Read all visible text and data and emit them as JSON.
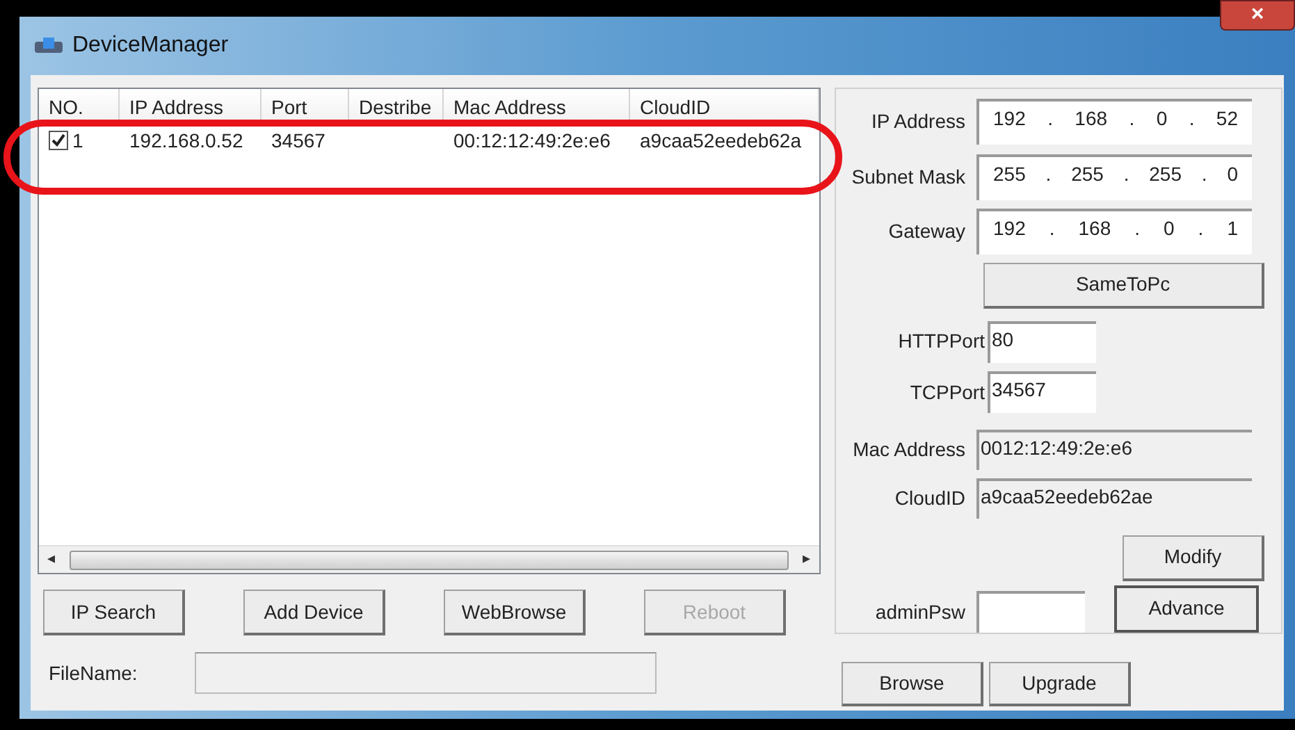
{
  "window": {
    "title": "DeviceManager",
    "close": "×"
  },
  "table": {
    "columns": [
      "NO.",
      "IP Address",
      "Port",
      "Destribe",
      "Mac Address",
      "CloudID"
    ],
    "rows": [
      {
        "checked": true,
        "selected": false,
        "cells": [
          "1",
          "192.168.0.52",
          "34567",
          "",
          "00:12:12:49:2e:e6",
          "a9caa52eedeb62a"
        ]
      }
    ],
    "scroll_left": "◂",
    "scroll_right": "▸"
  },
  "buttons": [
    {
      "label": "IP Search",
      "disabled": false
    },
    {
      "label": "Add Device",
      "disabled": false
    },
    {
      "label": "WebBrowse",
      "disabled": false
    },
    {
      "label": "Reboot",
      "disabled": true
    }
  ],
  "file": {
    "label": "FileName:"
  },
  "settings": {
    "octet_separator": ".",
    "ip_fields": [
      {
        "label": "IP Address",
        "octets": [
          "192",
          "168",
          "0",
          "52"
        ]
      },
      {
        "label": "Subnet Mask",
        "octets": [
          "255",
          "255",
          "255",
          "0"
        ]
      },
      {
        "label": "Gateway",
        "octets": [
          "192",
          "168",
          "0",
          "1"
        ]
      }
    ],
    "same_button": "SameToPc",
    "port_fields": [
      {
        "label": "HTTPPort",
        "value": "80"
      },
      {
        "label": "TCPPort",
        "value": "34567"
      }
    ],
    "info_fields": [
      {
        "label": "Mac Address",
        "value": "0012:12:49:2e:e6"
      },
      {
        "label": "CloudID",
        "value": "a9caa52eedeb62ae"
      }
    ],
    "modify_button": "Modify",
    "password": {
      "label": "adminPsw"
    },
    "advance_button": "Advance"
  },
  "bottom_buttons": [
    "Browse",
    "Upgrade"
  ],
  "annotation": {
    "shown": true
  }
}
